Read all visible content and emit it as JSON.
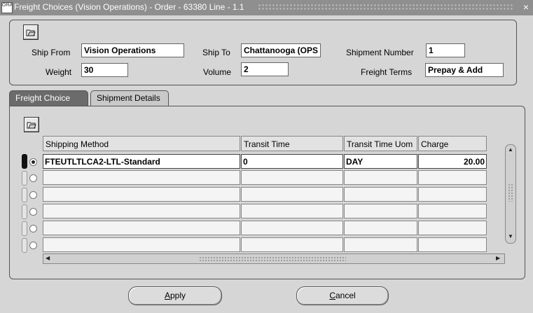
{
  "window": {
    "title": "Freight Choices (Vision Operations) - Order - 63380 Line - 1.1",
    "app_icon": "oracle-forms-icon",
    "close_glyph": "×"
  },
  "header": {
    "ship_from": {
      "label": "Ship From",
      "value": "Vision Operations"
    },
    "ship_to": {
      "label": "Ship To",
      "value": "Chattanooga (OPS"
    },
    "shipment_number": {
      "label": "Shipment Number",
      "value": "1"
    },
    "weight": {
      "label": "Weight",
      "value": "30"
    },
    "volume": {
      "label": "Volume",
      "value": "2"
    },
    "freight_terms": {
      "label": "Freight Terms",
      "value": "Prepay & Add"
    }
  },
  "tabs": [
    {
      "label": "Freight Choice",
      "active": true
    },
    {
      "label": "Shipment Details",
      "active": false
    }
  ],
  "table": {
    "columns": [
      "Shipping Method",
      "Transit Time",
      "Transit Time Uom",
      "Charge"
    ],
    "rows": [
      {
        "shipping_method": "FTEUTLTLCA2-LTL-Standard",
        "transit_time": "0",
        "transit_time_uom": "DAY",
        "charge": "20.00",
        "selected": true
      },
      {
        "shipping_method": "",
        "transit_time": "",
        "transit_time_uom": "",
        "charge": "",
        "selected": false
      },
      {
        "shipping_method": "",
        "transit_time": "",
        "transit_time_uom": "",
        "charge": "",
        "selected": false
      },
      {
        "shipping_method": "",
        "transit_time": "",
        "transit_time_uom": "",
        "charge": "",
        "selected": false
      },
      {
        "shipping_method": "",
        "transit_time": "",
        "transit_time_uom": "",
        "charge": "",
        "selected": false
      },
      {
        "shipping_method": "",
        "transit_time": "",
        "transit_time_uom": "",
        "charge": "",
        "selected": false
      }
    ]
  },
  "buttons": {
    "apply": {
      "mnemonic": "A",
      "rest": "pply"
    },
    "cancel": {
      "mnemonic": "C",
      "rest": "ancel"
    }
  },
  "icons": {
    "folder": "open-folder-icon"
  }
}
